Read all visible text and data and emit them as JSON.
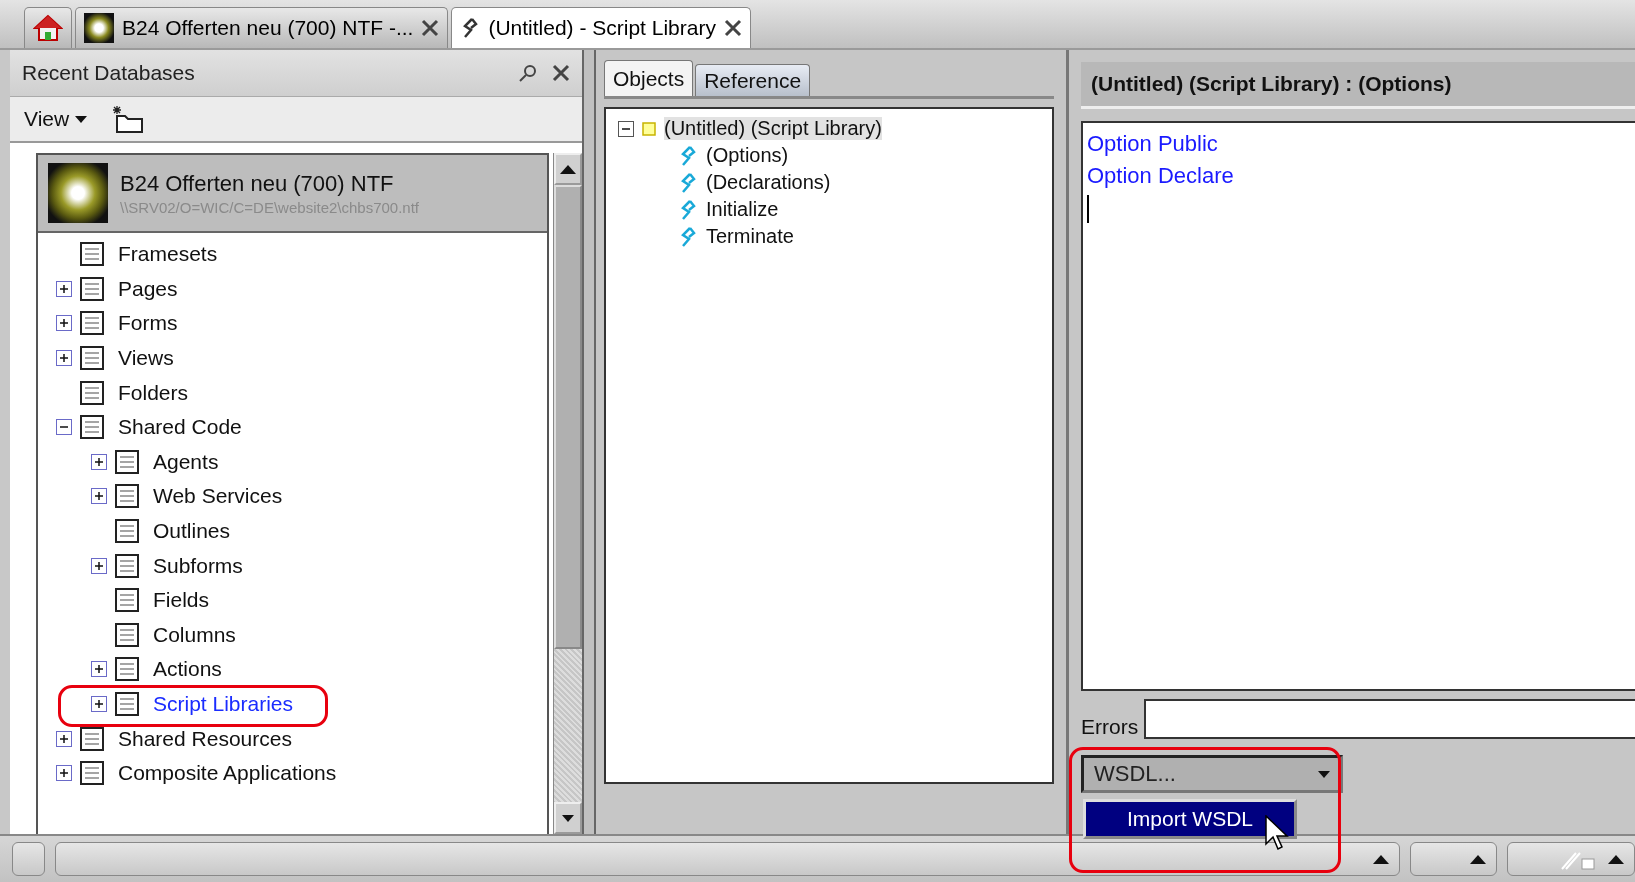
{
  "tabs": [
    {
      "kind": "home",
      "selected": false
    },
    {
      "kind": "database",
      "label": "B24 Offerten neu (700) NTF -...",
      "selected": false
    },
    {
      "kind": "script",
      "label": "(Untitled) - Script Library",
      "selected": true
    }
  ],
  "recent_databases": {
    "title": "Recent Databases",
    "view_menu": "View",
    "database": {
      "name": "B24 Offerten neu (700) NTF",
      "path": "\\\\SRV02/O=WIC/C=DE\\website2\\chbs700.ntf"
    },
    "tree": [
      {
        "label": "Framesets",
        "kind": "leaf",
        "selected": false
      },
      {
        "label": "Pages",
        "kind": "branch",
        "expanded": false,
        "selected": false
      },
      {
        "label": "Forms",
        "kind": "branch",
        "expanded": false,
        "selected": false
      },
      {
        "label": "Views",
        "kind": "branch",
        "expanded": false,
        "selected": false
      },
      {
        "label": "Folders",
        "kind": "leaf",
        "selected": false
      },
      {
        "label": "Shared Code",
        "kind": "branch",
        "expanded": true,
        "selected": false,
        "children": [
          {
            "label": "Agents",
            "kind": "branch",
            "expanded": false,
            "selected": false
          },
          {
            "label": "Web Services",
            "kind": "branch",
            "expanded": false,
            "selected": false
          },
          {
            "label": "Outlines",
            "kind": "leaf",
            "selected": false
          },
          {
            "label": "Subforms",
            "kind": "branch",
            "expanded": false,
            "selected": false
          },
          {
            "label": "Fields",
            "kind": "leaf",
            "selected": false
          },
          {
            "label": "Columns",
            "kind": "leaf",
            "selected": false
          },
          {
            "label": "Actions",
            "kind": "branch",
            "expanded": false,
            "selected": false
          },
          {
            "label": "Script Libraries",
            "kind": "branch",
            "expanded": false,
            "selected": true,
            "annotated": true
          }
        ]
      },
      {
        "label": "Shared Resources",
        "kind": "branch",
        "expanded": false,
        "selected": false
      },
      {
        "label": "Composite Applications",
        "kind": "branch",
        "expanded": false,
        "selected": false
      }
    ]
  },
  "objects_panel": {
    "tabs": [
      {
        "label": "Objects",
        "selected": true
      },
      {
        "label": "Reference",
        "selected": false
      }
    ],
    "tree": [
      {
        "label": "(Untitled) (Script Library)",
        "expanded": true,
        "selected": true,
        "children": [
          {
            "label": "(Options)",
            "selected": false
          },
          {
            "label": "(Declarations)",
            "selected": false
          },
          {
            "label": "Initialize",
            "selected": false
          },
          {
            "label": "Terminate",
            "selected": false
          }
        ]
      }
    ]
  },
  "editor": {
    "title": "(Untitled) (Script Library) : (Options)",
    "lines": [
      "Option Public",
      "Option Declare"
    ],
    "errors_label": "Errors",
    "dropdown": {
      "value": "WSDL...",
      "annotated": true,
      "menu": [
        {
          "label": "Import WSDL",
          "selected": true
        }
      ]
    }
  }
}
